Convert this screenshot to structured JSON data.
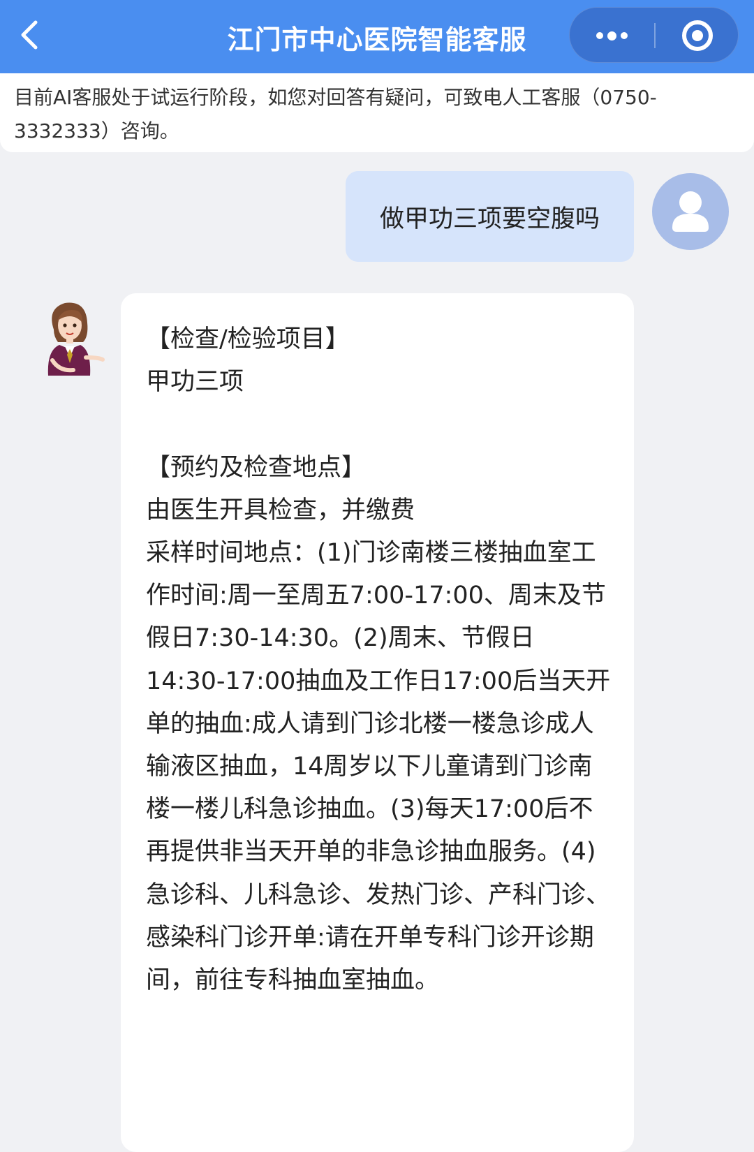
{
  "header": {
    "title": "江门市中心医院智能客服",
    "back_icon": "chevron-left-icon",
    "more_icon": "more-dots-icon",
    "close_icon": "target-close-icon",
    "background": "#4a8ef0"
  },
  "notice": {
    "text": "目前AI客服处于试运行阶段，如您对回答有疑问，可致电人工客服（0750-3332333）咨询。"
  },
  "chat": {
    "user_message": "做甲功三项要空腹吗",
    "bot_reply": {
      "section1_title": "【检查/检验项目】",
      "section1_body": "甲功三项",
      "section2_title": "【预约及检查地点】",
      "section2_line1": "由医生开具检查，并缴费",
      "section2_body": "采样时间地点：(1)门诊南楼三楼抽血室工作时间:周一至周五7:00-17:00、周末及节假日7:30-14:30。(2)周末、节假日14:30-17:00抽血及工作日17:00后当天开单的抽血:成人请到门诊北楼一楼急诊成人输液区抽血，14周岁以下儿童请到门诊南楼一楼儿科急诊抽血。(3)每天17:00后不再提供非当天开单的非急诊抽血服务。(4)急诊科、儿科急诊、发热门诊、产科门诊、感染科门诊开单:请在开单专科门诊开诊期间，前往专科抽血室抽血。"
    }
  },
  "colors": {
    "user_bubble": "#d6e4fb",
    "bot_bubble": "#ffffff",
    "page_background": "#f0f1f4"
  }
}
